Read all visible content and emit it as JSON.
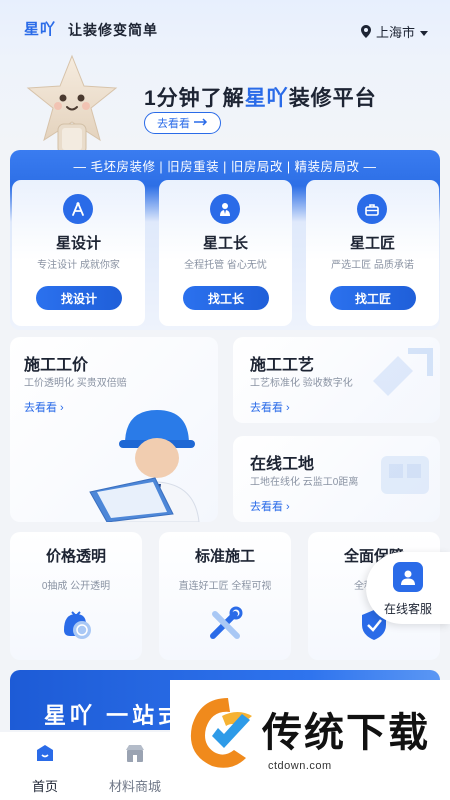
{
  "header": {
    "brand": "星吖",
    "slogan": "让装修变简单",
    "city": "上海市"
  },
  "hero": {
    "title_prefix": "1分钟了解",
    "title_brand": "星吖",
    "title_suffix": "装修平台",
    "button_label": "去看看"
  },
  "services": {
    "header": "— 毛坯房装修 | 旧房重装 | 旧房局改 | 精装房局改 —",
    "cards": [
      {
        "name": "星设计",
        "desc": "专注设计 成就你家",
        "button": "找设计",
        "icon": "compass-icon"
      },
      {
        "name": "星工长",
        "desc": "全程托管 省心无忧",
        "button": "找工长",
        "icon": "foreman-icon"
      },
      {
        "name": "星工匠",
        "desc": "严选工匠 品质承诺",
        "button": "找工匠",
        "icon": "toolbox-icon"
      }
    ]
  },
  "features": {
    "price": {
      "title": "施工工价",
      "desc": "工价透明化 买贵双倍赔",
      "link": "去看看"
    },
    "craft": {
      "title": "施工工艺",
      "desc": "工艺标准化 验收数字化",
      "link": "去看看"
    },
    "site": {
      "title": "在线工地",
      "desc": "工地在线化 云监工0距离",
      "link": "去看看"
    }
  },
  "guarantees": [
    {
      "title": "价格透明",
      "desc": "0抽成 公开透明",
      "icon": "price-tag-icon"
    },
    {
      "title": "标准施工",
      "desc": "直连好工匠 全程可视",
      "icon": "tools-icon"
    },
    {
      "title": "全面保障",
      "desc": "全程保障",
      "icon": "shield-icon"
    }
  ],
  "customer_service": {
    "label": "在线客服",
    "icon": "service-agent-icon"
  },
  "banner": {
    "text": "星吖 一站式"
  },
  "tabbar": {
    "items": [
      {
        "label": "首页",
        "icon": "home-icon",
        "active": true
      },
      {
        "label": "材料商城",
        "icon": "store-icon",
        "active": false
      }
    ]
  },
  "watermark": {
    "title": "传统下载",
    "url": "ctdown.com"
  },
  "colors": {
    "accent": "#2a6be8",
    "text": "#1d2433",
    "muted": "#8a93a3",
    "background": "#f2f4f8"
  }
}
